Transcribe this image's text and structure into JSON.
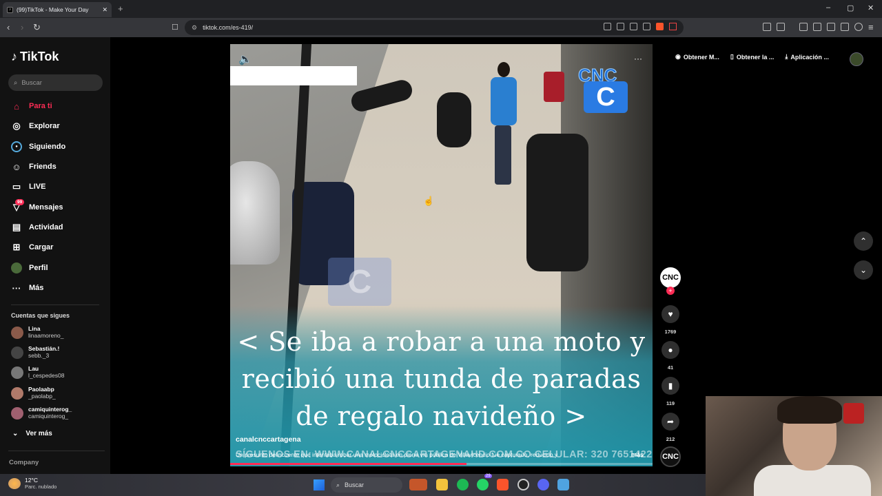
{
  "browser": {
    "tab_title": "(99)TikTok - Make Your Day",
    "new_tab": "+",
    "url": "tiktok.com/es-419/",
    "window_controls": [
      "–",
      "▢",
      "✕"
    ]
  },
  "sidebar": {
    "logo": "TikTok",
    "search_placeholder": "Buscar",
    "nav": [
      {
        "label": "Para ti",
        "icon": "home-icon",
        "active": true
      },
      {
        "label": "Explorar",
        "icon": "compass-icon"
      },
      {
        "label": "Siguiendo",
        "icon": "following-icon"
      },
      {
        "label": "Friends",
        "icon": "friends-icon"
      },
      {
        "label": "LIVE",
        "icon": "live-icon"
      },
      {
        "label": "Mensajes",
        "icon": "messages-icon"
      },
      {
        "label": "Actividad",
        "icon": "activity-icon"
      },
      {
        "label": "Cargar",
        "icon": "upload-icon"
      },
      {
        "label": "Perfil",
        "icon": "profile-icon"
      },
      {
        "label": "Más",
        "icon": "more-icon"
      }
    ],
    "messages_badge": "99",
    "following_title": "Cuentas que sigues",
    "accounts": [
      {
        "name": "Lina",
        "username": "linaamoreno_"
      },
      {
        "name": "Sebastián.!",
        "username": "sebb._3"
      },
      {
        "name": "Lau",
        "username": "l_cespedes08"
      },
      {
        "name": "Paolaabp",
        "username": "_paolabp_"
      },
      {
        "name": "camiquinterog_",
        "username": "camiquinterog_"
      }
    ],
    "see_more": "Ver más",
    "company": "Company"
  },
  "video": {
    "caption_lines": [
      "< Se iba a robar a una moto y",
      "recibió una tunda de paradas",
      "de regalo navideño >"
    ],
    "footer_watermark": "SÍGUENOS EN: WWW.CANALCNCCARTAGENAHD.COM.CO CELULAR: 320 7651422",
    "author": "canalcnccartagena",
    "description": "Un presunto delincuente que intentaba robar una motocicleta en plena vía pública de Villavicencio fue capturado, reducido y",
    "description_more": "más",
    "logo_text": "CNC",
    "logo_letter": "C",
    "progress": 0.56
  },
  "actions": {
    "avatar_text": "CNC",
    "follow": "+",
    "likes": "1769",
    "comments": "41",
    "saves": "119",
    "shares": "212",
    "music_avatar_text": "CNC"
  },
  "topbar": {
    "get_coins": "Obtener M...",
    "get_app": "Obtener la ...",
    "desktop_app": "Aplicación ..."
  },
  "taskbar": {
    "temperature": "12°C",
    "condition": "Parc. nublado",
    "search_label": "Buscar",
    "whatsapp_badge": "29"
  }
}
